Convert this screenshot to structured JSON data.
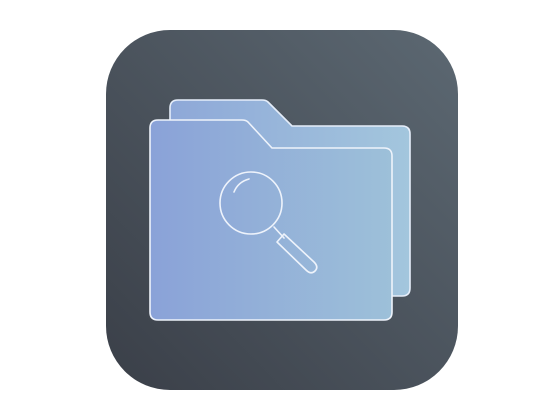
{
  "icon": {
    "name": "folder-search-app-icon",
    "background_colors": [
      "#3a3f48",
      "#5a6670"
    ],
    "folder_colors": [
      "#8aa4d6",
      "#9ec0da"
    ],
    "stroke_color": "#eef3fb"
  }
}
